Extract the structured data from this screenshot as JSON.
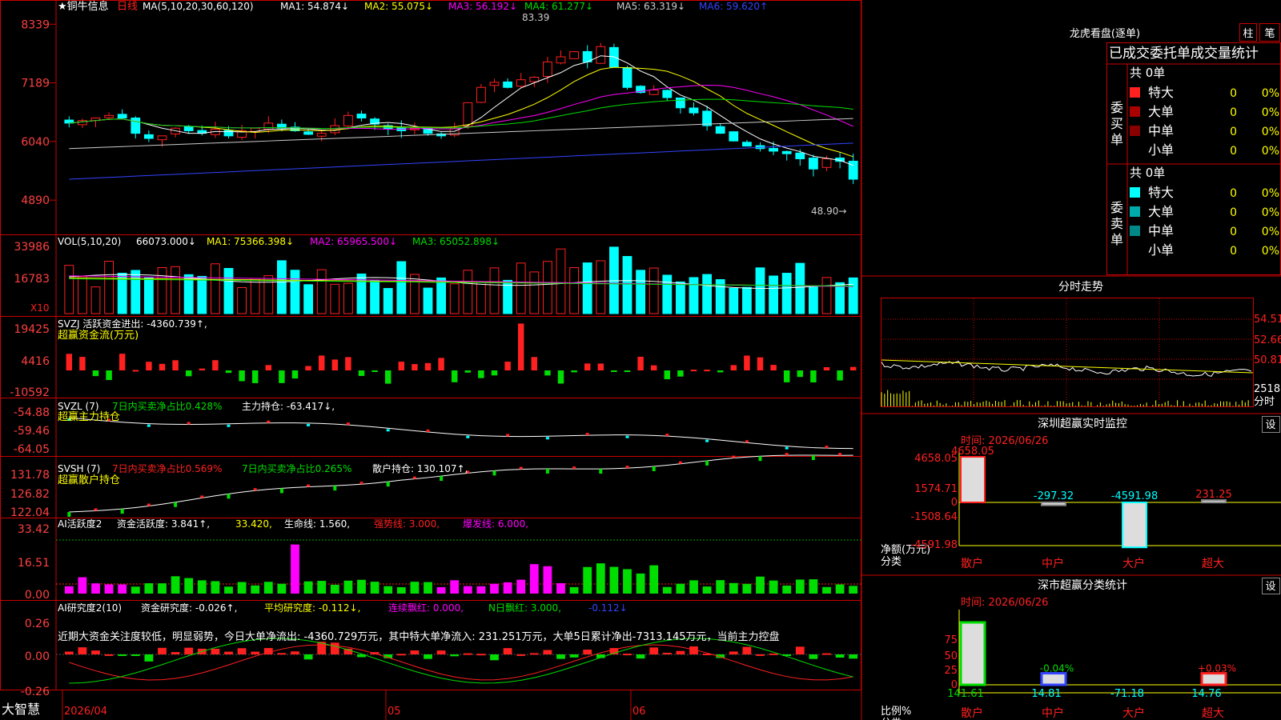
{
  "colors": {
    "up": "#ff2020",
    "down": "#00ffff",
    "green": "#00dd00",
    "yellow": "#ffff00",
    "magenta": "#ff00ff",
    "white": "#ffffff",
    "label": "#ff4040",
    "grid": "#cc0000",
    "cyan": "#00ffff"
  },
  "kline": {
    "title": "★铜牛信息",
    "period": "日线",
    "ma_header": "MA(5,10,20,30,60,120)",
    "ma": [
      "MA1: 54.874↓",
      "MA2: 55.075↓",
      "MA3: 56.192↓",
      "MA4: 61.277↓",
      "MA5: 63.319↓",
      "MA6: 59.620↑"
    ],
    "yticks": [
      "8339",
      "7189",
      "6040",
      "4890"
    ],
    "high_label": "83.39",
    "low_label": "48.90→",
    "ylim": [
      4500,
      8500
    ]
  },
  "vol": {
    "header": "VOL(5,10,20)",
    "value": "66073.000↓",
    "ma": [
      "MA1: 75366.398↓",
      "MA2: 65965.500↓",
      "MA3: 65052.898↓"
    ],
    "yticks": [
      "33986",
      "16783"
    ],
    "unit": "X10"
  },
  "svzj": {
    "header": "SVZJ  活跃资金进出: -4360.739↑,",
    "sub": "超赢资金流(万元)",
    "yticks": [
      "19425",
      "4416",
      "-10592"
    ]
  },
  "svzl": {
    "header": "SVZL (7)",
    "h1": "7日内买卖净占比0.428%",
    "h2": "主力持仓: -63.417↓,",
    "sub": "超赢主力持仓",
    "yticks": [
      "-54.88",
      "-59.46",
      "-64.05"
    ]
  },
  "svsh": {
    "header": "SVSH (7)",
    "h1": "7日内买卖净占比0.569%",
    "h2": "7日内买卖净占比0.265%",
    "h3": "散户持仓: 130.107↑,",
    "sub": "超赢散户持仓",
    "yticks": [
      "131.78",
      "126.82",
      "122.04"
    ]
  },
  "ai": {
    "header": "AI活跃度2",
    "h1": "资金活跃度: 3.841↑,",
    "h2": "33.420,",
    "h3": "生命线: 1.560,",
    "h4": "强势线: 3.000,",
    "h5": "爆发线: 6.000,",
    "yticks": [
      "33.42",
      "16.51",
      "0.00"
    ]
  },
  "air": {
    "header": "AI研究度2(10)",
    "h1": "资金研究度: -0.026↑,",
    "h2": "平均研究度: -0.112↓,",
    "h3": "连续飘红: 0.000,",
    "h4": "N日飘红: 3.000,",
    "h5": "-0.112↓",
    "text": "近期大资金关注度较低，明显弱势，今日大单净流出: -4360.729万元，其中特大单净流入: 231.251万元，大单5日累计净出-7313.145万元，当前主力控盘",
    "yticks": [
      "0.26",
      "0.00",
      "-0.26"
    ]
  },
  "xaxis": {
    "brand": "大智慧",
    "labels": [
      "2026/04",
      "05",
      "06"
    ]
  },
  "dragon": {
    "title": "龙虎看盘(逐单)",
    "btn1": "柱",
    "btn2": "笔",
    "subtitle": "已成交委托单成交量统计",
    "buy": {
      "side": "委买单",
      "total": "共 0单",
      "rows": [
        {
          "name": "特大",
          "v": "0",
          "p": "0%"
        },
        {
          "name": "大单",
          "v": "0",
          "p": "0%"
        },
        {
          "name": "中单",
          "v": "0",
          "p": "0%"
        },
        {
          "name": "小单",
          "v": "0",
          "p": "0%"
        }
      ]
    },
    "sell": {
      "side": "委卖单",
      "total": "共 0单",
      "rows": [
        {
          "name": "特大",
          "v": "0",
          "p": "0%"
        },
        {
          "name": "大单",
          "v": "0",
          "p": "0%"
        },
        {
          "name": "中单",
          "v": "0",
          "p": "0%"
        },
        {
          "name": "小单",
          "v": "0",
          "p": "0%"
        }
      ]
    }
  },
  "intraday": {
    "title": "分时走势",
    "yticks": [
      "54.51",
      "52.66",
      "50.81"
    ],
    "vol_tick": "2518",
    "vol_unit": "分时"
  },
  "monitor": {
    "title": "深圳超赢实时监控",
    "btn": "设",
    "time": "时间: 2026/06/26",
    "yticks": [
      "4658.05",
      "1574.71",
      "0",
      "-1508.64",
      "-4591.98"
    ],
    "ylabel1": "净额(万元)",
    "ylabel2": "分类",
    "bars": [
      {
        "name": "散户",
        "value": 4658.05,
        "label": "4658.05"
      },
      {
        "name": "中户",
        "value": -297.32,
        "label": "-297.32"
      },
      {
        "name": "大户",
        "value": -4591.98,
        "label": "-4591.98"
      },
      {
        "name": "超大",
        "value": 231.25,
        "label": "231.25"
      }
    ]
  },
  "classify": {
    "title": "深市超赢分类统计",
    "btn": "设",
    "time": "时间: 2026/06/26",
    "yticks": [
      "75",
      "50",
      "25",
      "0"
    ],
    "ylabel1": "比例%",
    "ylabel2": "分类",
    "bars": [
      {
        "name": "散户",
        "value": 141.61,
        "label": "141.61",
        "top": ""
      },
      {
        "name": "中户",
        "value": 14.81,
        "label": "14.81",
        "top": "-0.04%"
      },
      {
        "name": "大户",
        "value": -71.18,
        "label": "-71.18",
        "top": ""
      },
      {
        "name": "超大",
        "value": 14.76,
        "label": "14.76",
        "top": "+0.03%"
      }
    ]
  }
}
